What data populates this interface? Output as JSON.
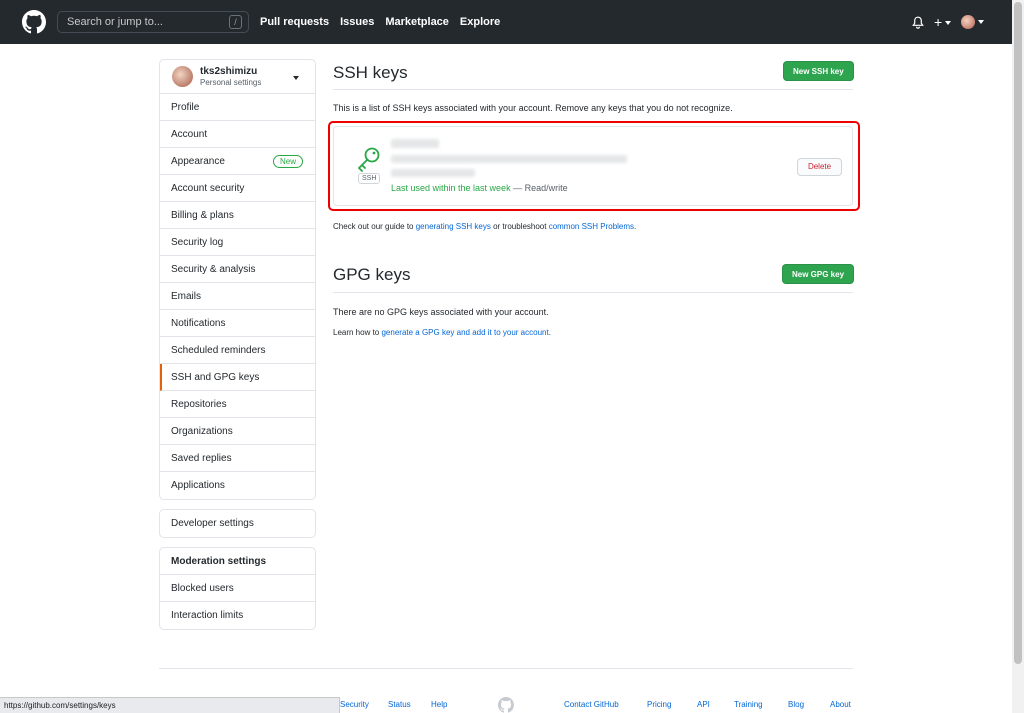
{
  "header": {
    "search_placeholder": "Search or jump to...",
    "search_key": "/",
    "nav": [
      "Pull requests",
      "Issues",
      "Marketplace",
      "Explore"
    ],
    "plus": "+"
  },
  "sidebar": {
    "username": "tks2shimizu",
    "subtitle": "Personal settings",
    "items": [
      {
        "label": "Profile"
      },
      {
        "label": "Account"
      },
      {
        "label": "Appearance",
        "badge": "New"
      },
      {
        "label": "Account security"
      },
      {
        "label": "Billing & plans"
      },
      {
        "label": "Security log"
      },
      {
        "label": "Security & analysis"
      },
      {
        "label": "Emails"
      },
      {
        "label": "Notifications"
      },
      {
        "label": "Scheduled reminders"
      },
      {
        "label": "SSH and GPG keys",
        "selected": true
      },
      {
        "label": "Repositories"
      },
      {
        "label": "Organizations"
      },
      {
        "label": "Saved replies"
      },
      {
        "label": "Applications"
      }
    ],
    "developer": "Developer settings",
    "moderation": {
      "heading": "Moderation settings",
      "items": [
        "Blocked users",
        "Interaction limits"
      ]
    }
  },
  "ssh": {
    "title": "SSH keys",
    "new_button": "New SSH key",
    "description": "This is a list of SSH keys associated with your account. Remove any keys that you do not recognize.",
    "key": {
      "badge": "SSH",
      "last_used": "Last used within the last week",
      "access": " — Read/write",
      "delete": "Delete"
    },
    "guide_prefix": "Check out our guide to ",
    "guide_link": "generating SSH keys",
    "guide_mid": " or troubleshoot ",
    "guide_link2": "common SSH Problems",
    "guide_suffix": "."
  },
  "gpg": {
    "title": "GPG keys",
    "new_button": "New GPG key",
    "empty": "There are no GPG keys associated with your account.",
    "learn_prefix": "Learn how to ",
    "learn_link": "generate a GPG key and add it to your account",
    "learn_suffix": "."
  },
  "footer": {
    "links": [
      "Security",
      "Status",
      "Help",
      "Contact GitHub",
      "Pricing",
      "API",
      "Training",
      "Blog",
      "About"
    ]
  },
  "statusbar": "https://github.com/settings/keys",
  "colors": {
    "header": "#24292e",
    "green": "#2ea44f",
    "link": "#0366d6",
    "highlight": "#e00000",
    "danger": "#cb2431"
  }
}
